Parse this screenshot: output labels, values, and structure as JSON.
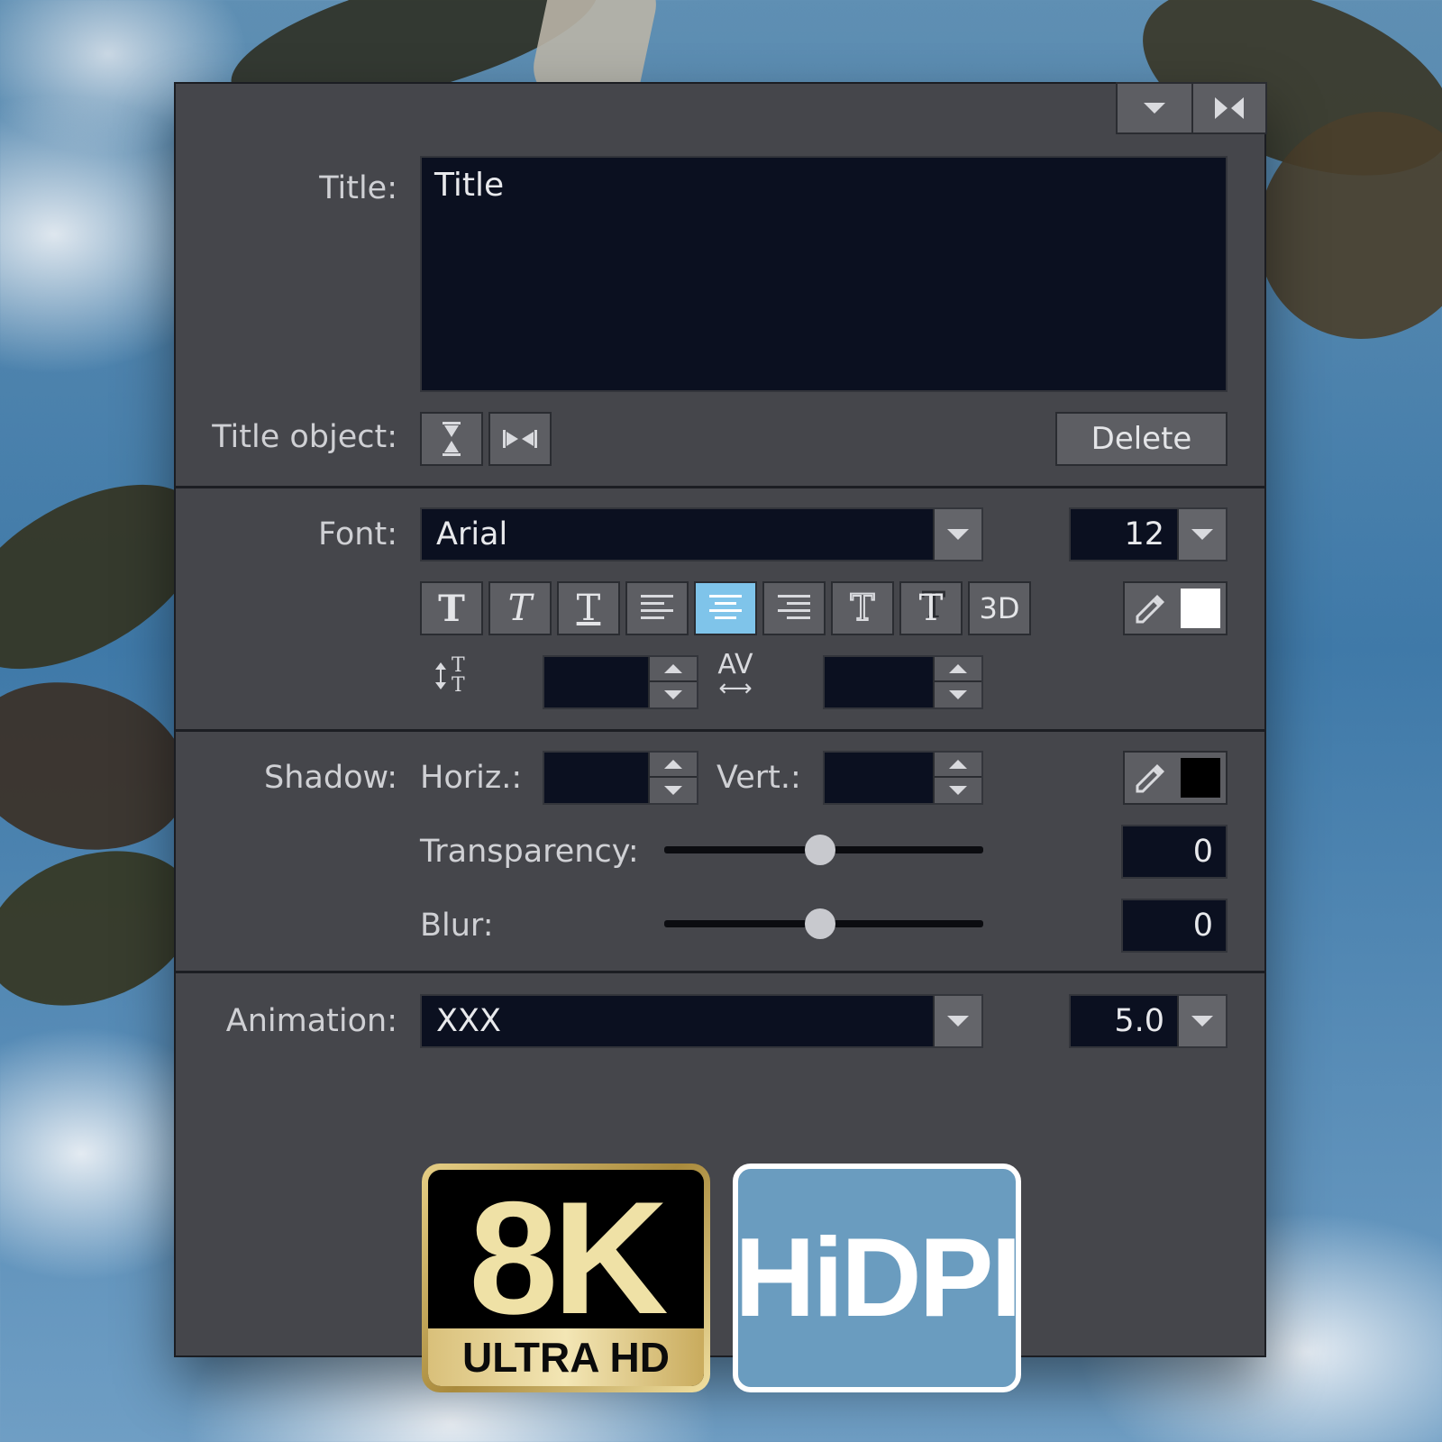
{
  "window_controls": {
    "collapse_icon": "chevron-down-icon",
    "dock_icon": "dock-toggle-icon"
  },
  "title_section": {
    "label": "Title:",
    "value": "Title",
    "object_label": "Title object:",
    "delete_label": "Delete"
  },
  "font_section": {
    "label": "Font:",
    "font_value": "Arial",
    "size_value": "12",
    "format_buttons": [
      {
        "name": "bold",
        "glyph": "T"
      },
      {
        "name": "italic",
        "glyph": "T"
      },
      {
        "name": "underline",
        "glyph": "T"
      },
      {
        "name": "align-left"
      },
      {
        "name": "align-center",
        "active": true
      },
      {
        "name": "align-right"
      },
      {
        "name": "outline",
        "glyph": "T"
      },
      {
        "name": "shadow",
        "glyph": "T"
      },
      {
        "name": "3d",
        "glyph": "3D"
      }
    ],
    "color_hex": "#ffffff",
    "line_spacing_value": "",
    "kerning_value": "",
    "kerning_icon_text": "AV"
  },
  "shadow_section": {
    "label": "Shadow:",
    "horiz_label": "Horiz.:",
    "vert_label": "Vert.:",
    "horiz_value": "",
    "vert_value": "",
    "color_hex": "#000000",
    "transparency_label": "Transparency:",
    "transparency_value": "0",
    "transparency_slider_fraction": 0.49,
    "blur_label": "Blur:",
    "blur_value": "0",
    "blur_slider_fraction": 0.49
  },
  "animation_section": {
    "label": "Animation:",
    "value": "XXX",
    "duration_value": "5.0"
  },
  "badges": {
    "badge_8k_big": "8K",
    "badge_8k_small": "ULTRA HD",
    "badge_hidpi": "HiDPI"
  },
  "colors": {
    "panel": "#45464b",
    "field": "#0b1020",
    "accent": "#7fc4ea"
  }
}
